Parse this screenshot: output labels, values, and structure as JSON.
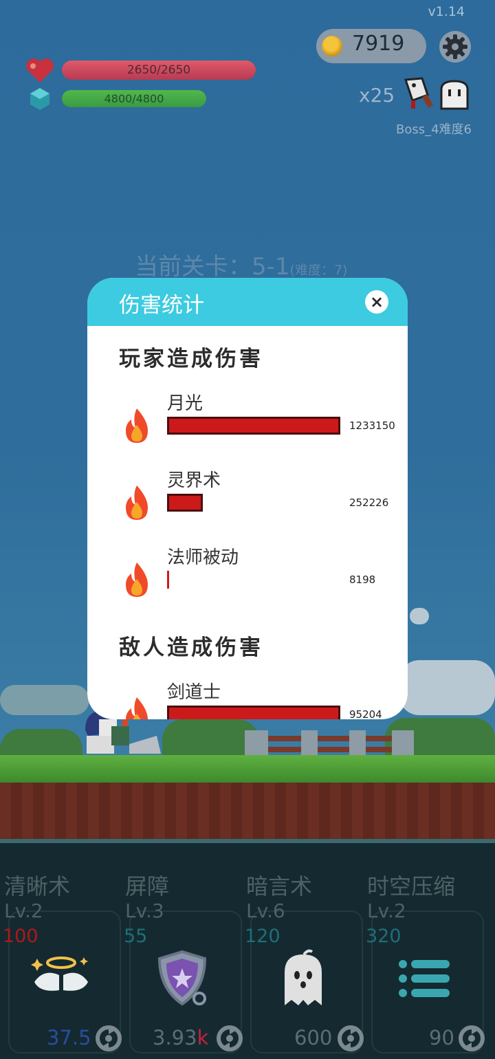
{
  "version": "v1.14",
  "player": {
    "hp_text": "2650/2650",
    "hp_fraction": 1.0,
    "mp_text": "4800/4800",
    "mp_fraction": 1.0
  },
  "coins": "7919",
  "enemy": {
    "combo": "x25",
    "boss_label": "Boss_4难度6"
  },
  "stage": {
    "label": "当前关卡：5-1",
    "difficulty": "(难度：7)"
  },
  "modal": {
    "title": "伤害统计",
    "close": "×",
    "player_section": "玩家造成伤害",
    "enemy_section": "敌人造成伤害",
    "player_rows": [
      {
        "name": "月光",
        "value": "1233150",
        "fraction": 1.0
      },
      {
        "name": "灵界术",
        "value": "252226",
        "fraction": 0.2045
      },
      {
        "name": "法师被动",
        "value": "8198",
        "fraction": 0.0066
      }
    ],
    "enemy_rows": [
      {
        "name": "剑道士",
        "value": "95204",
        "fraction": 1.0
      }
    ]
  },
  "skills": [
    {
      "name": "清晰术",
      "level": "Lv.2",
      "cost": "100",
      "cost_color": "#b01818",
      "value": "37.5",
      "value_color": "#2a4ca0",
      "icon": "angel-wings-halo-icon"
    },
    {
      "name": "屏障",
      "level": "Lv.3",
      "cost": "55",
      "cost_color": "#1f6e7a",
      "value": "3.93",
      "suffix": "k",
      "value_color": "#5c6e73",
      "icon": "shield-star-icon"
    },
    {
      "name": "暗言术",
      "level": "Lv.6",
      "cost": "120",
      "cost_color": "#1f6e7a",
      "value": "600",
      "value_color": "#5c6e73",
      "icon": "ghost-icon"
    },
    {
      "name": "时空压缩",
      "level": "Lv.2",
      "cost": "320",
      "cost_color": "#1f6e7a",
      "value": "90",
      "value_color": "#5c6e73",
      "icon": "list-icon"
    }
  ],
  "colors": {
    "accent": "#3ccbe0",
    "damage_bar": "#cc1a1a",
    "hp": "#c84a5e",
    "mp": "#45a848"
  }
}
